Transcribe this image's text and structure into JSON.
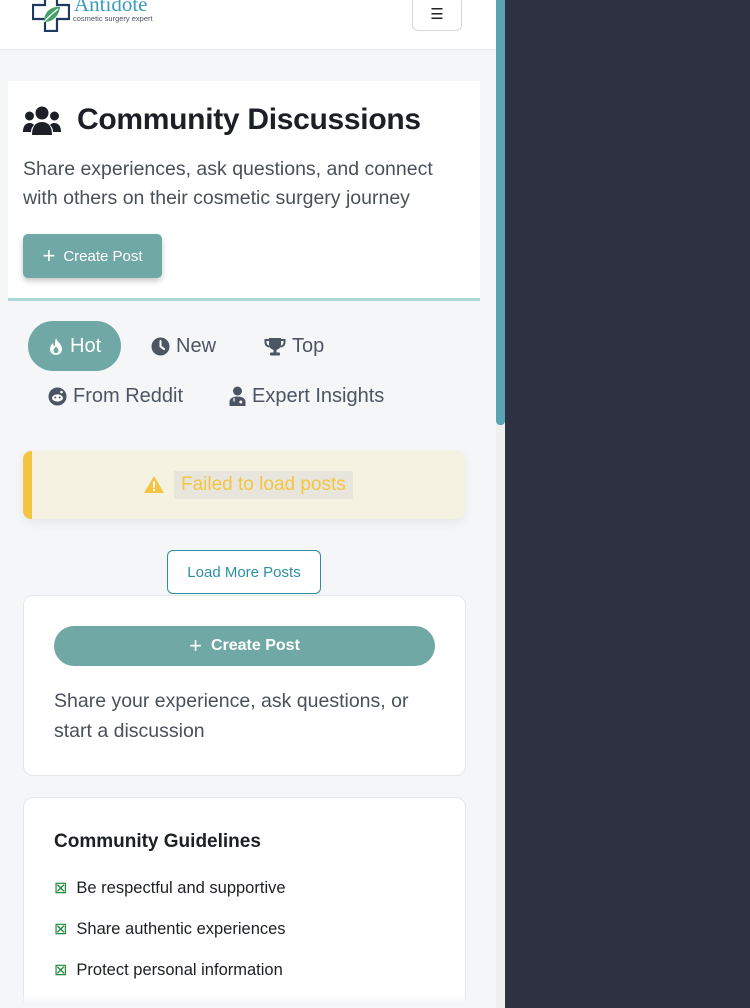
{
  "brand": {
    "name": "Antidote",
    "tagline": "cosmetic surgery expert",
    "accent": "#3a9bbd",
    "leaf_color": "#45a06a"
  },
  "header": {
    "menu_icon": "hamburger-icon",
    "menu_glyph": "☰"
  },
  "hero": {
    "icon": "users-icon",
    "title": "Community Discussions",
    "description": "Share experiences, ask questions, and connect with others on their cosmetic surgery journey",
    "create_label": "Create Post"
  },
  "tabs": [
    {
      "label": "Hot",
      "icon": "fire-icon",
      "active": true
    },
    {
      "label": "New",
      "icon": "clock-icon",
      "active": false
    },
    {
      "label": "Top",
      "icon": "trophy-icon",
      "active": false
    },
    {
      "label": "From Reddit",
      "icon": "reddit-icon",
      "active": false
    },
    {
      "label": "Expert Insights",
      "icon": "doctor-icon",
      "active": false
    }
  ],
  "alert": {
    "icon": "warning-icon",
    "message": "Failed to load posts",
    "color": "#f4c542"
  },
  "load_more_label": "Load More Posts",
  "create_card": {
    "button_label": "Create Post",
    "description": "Share your experience, ask questions, or start a discussion"
  },
  "guidelines": {
    "title": "Community Guidelines",
    "check_glyph": "⊠",
    "items": [
      "Be respectful and supportive",
      "Share authentic experiences",
      "Protect personal information"
    ]
  },
  "colors": {
    "primary": "#6fa8a5",
    "link": "#2e8fa1",
    "dark_panel": "#2e3142"
  }
}
